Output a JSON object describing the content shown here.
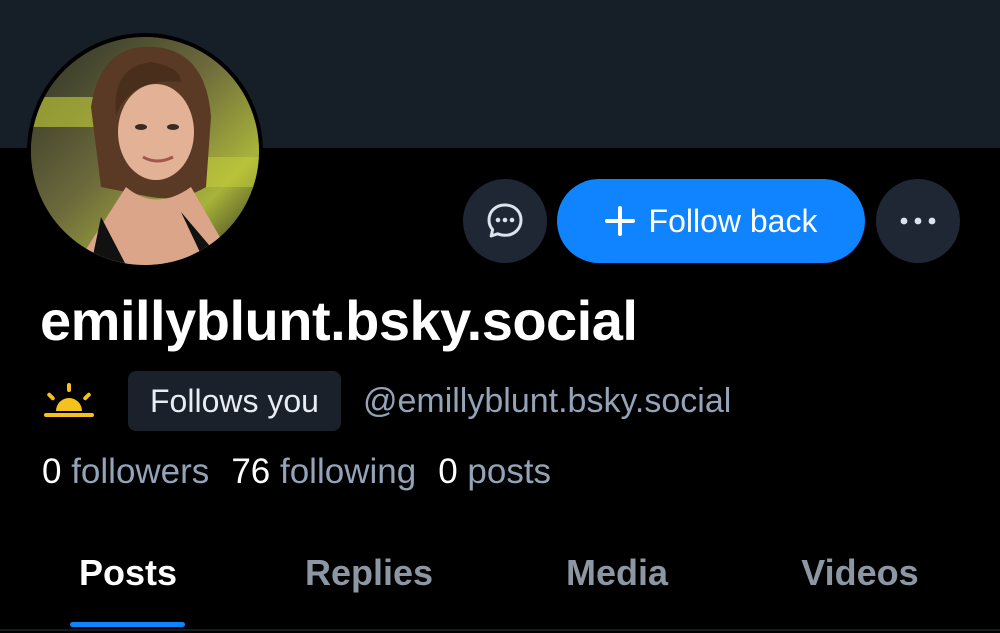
{
  "profile": {
    "display_name": "emillyblunt.bsky.social",
    "handle": "@emillyblunt.bsky.social",
    "follows_you_label": "Follows you",
    "avatar_icon": "profile-avatar",
    "mood_icon": "sunrise-icon"
  },
  "actions": {
    "message_icon": "chat-bubble-icon",
    "follow_back_label": "Follow back",
    "more_icon": "more-horizontal-icon"
  },
  "stats": {
    "followers": {
      "count": "0",
      "label": "followers"
    },
    "following": {
      "count": "76",
      "label": "following"
    },
    "posts": {
      "count": "0",
      "label": "posts"
    }
  },
  "tabs": [
    {
      "label": "Posts",
      "active": true
    },
    {
      "label": "Replies",
      "active": false
    },
    {
      "label": "Media",
      "active": false
    },
    {
      "label": "Videos",
      "active": false
    }
  ],
  "colors": {
    "banner": "#161e27",
    "accent": "#1083fe",
    "background": "#000000",
    "muted_text": "#93a3b8",
    "circle_button": "#1e2733",
    "badge_bg": "#1a212b",
    "sun": "#f5c21b"
  }
}
